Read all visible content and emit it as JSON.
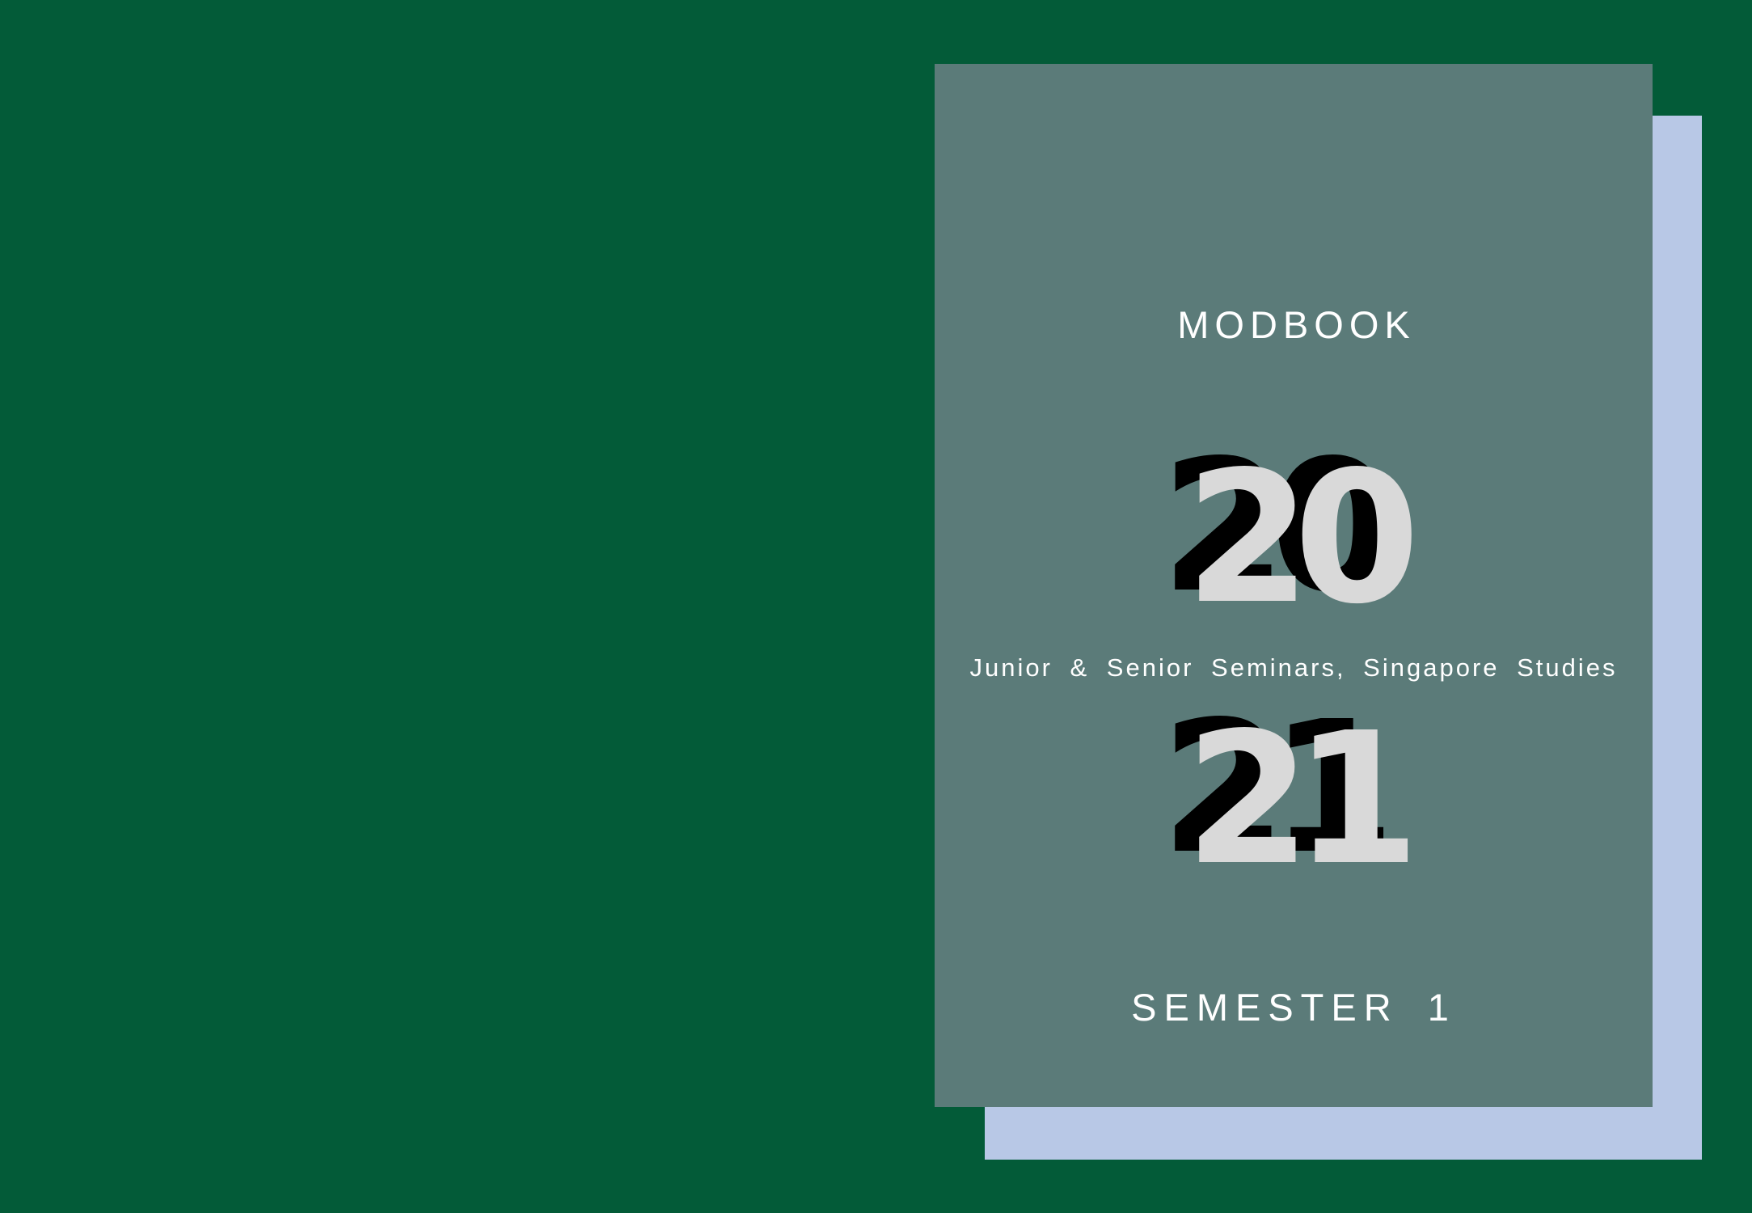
{
  "cover": {
    "title": "MODBOOK",
    "year_top": "20",
    "subtitle": "Junior & Senior Seminars, Singapore Studies",
    "year_bottom": "21",
    "semester": "SEMESTER 1"
  },
  "colors": {
    "background": "#035b38",
    "front_card": "#5b7b79",
    "back_card": "#b8c8e6",
    "year_face": "#d9d9d9",
    "year_shadow": "#000000",
    "text": "#ffffff"
  }
}
